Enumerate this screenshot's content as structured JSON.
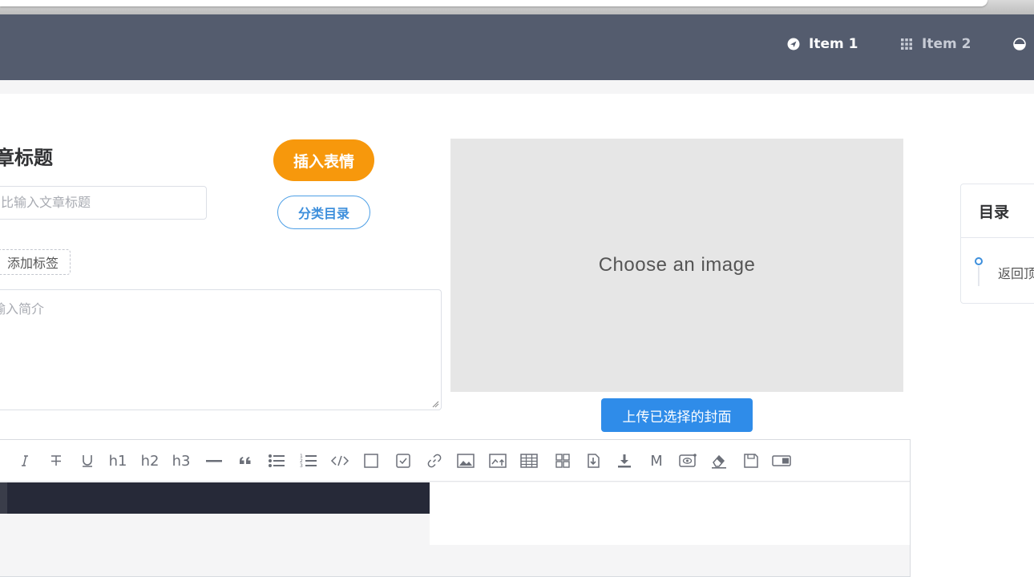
{
  "nav": {
    "items": [
      {
        "label": "Item 1",
        "icon": "navigation-icon",
        "active": true
      },
      {
        "label": "Item 2",
        "icon": "grid-icon",
        "active": false
      }
    ],
    "partial_icon": "theme-icon"
  },
  "form": {
    "title_label": "章标题",
    "title_placeholder": "比输入文章标题",
    "emoji_button": "插入表情",
    "category_button": "分类目录",
    "add_tag": "添加标签",
    "summary_placeholder": "输入简介"
  },
  "cover": {
    "placeholder": "Choose an image",
    "upload_button": "上传已选择的封面"
  },
  "toc": {
    "title": "目录",
    "item": "返回顶"
  },
  "toolbar": {
    "items": [
      "italic-icon",
      "strikethrough-icon",
      "underline-icon",
      "h1",
      "h2",
      "h3",
      "horizontal-rule-icon",
      "quote-icon",
      "unordered-list-icon",
      "ordered-list-icon",
      "code-icon",
      "checkbox-icon",
      "checked-checkbox-icon",
      "link-icon",
      "image-icon",
      "image-upload-icon",
      "table-icon",
      "grid-layout-icon",
      "import-icon",
      "download-icon",
      "markdown-icon",
      "preview-icon",
      "eraser-icon",
      "save-icon",
      "toggle-panel-icon"
    ],
    "h1": "h1",
    "h2": "h2",
    "h3": "h3",
    "markdown": "M"
  },
  "colors": {
    "navbar": "#545c6e",
    "accent_orange": "#f7980c",
    "accent_blue": "#2f8ce9",
    "cover_bg": "#e6e6e6",
    "editor_dark": "#262938"
  }
}
